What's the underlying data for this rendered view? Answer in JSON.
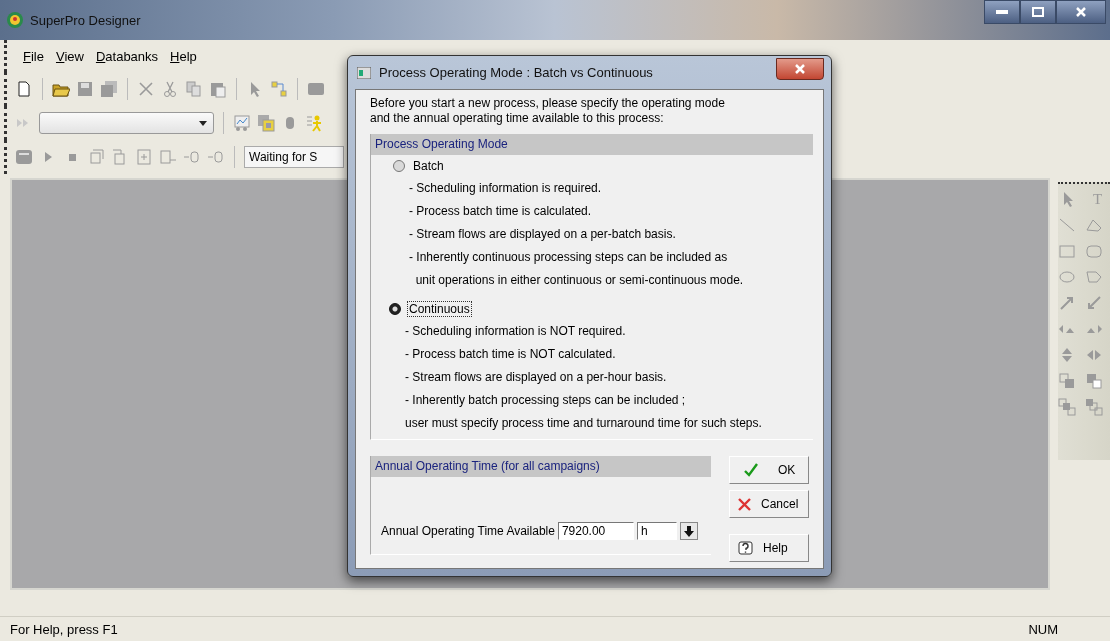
{
  "window": {
    "title": "SuperPro Designer"
  },
  "menu": [
    "File",
    "View",
    "Databanks",
    "Help"
  ],
  "toolbar": {
    "status_field": "Waiting for S"
  },
  "palette": {
    "text_tool": "T"
  },
  "dialog": {
    "title": "Process Operating Mode : Batch vs Continuous",
    "intro": [
      "Before you start a new process, please specify the operating mode",
      "and the annual operating time available to this process:"
    ],
    "mode_group": {
      "title": "Process Operating Mode",
      "options": [
        {
          "label": "Batch",
          "selected": false,
          "focused": false,
          "notes": [
            "- Scheduling information is required.",
            "- Process batch time is calculated.",
            "- Stream flows are displayed on a per-batch basis.",
            "- Inherently continuous processing steps can be included as",
            "  unit operations in either continuous or semi-continuous mode."
          ]
        },
        {
          "label": "Continuous",
          "selected": true,
          "focused": true,
          "notes": [
            "- Scheduling information is NOT required.",
            "- Process batch time is NOT calculated.",
            "- Stream flows are displayed on a per-hour basis.",
            "- Inherently batch processing steps can be included ;",
            "user must specify process time and turnaround time for such steps."
          ]
        }
      ]
    },
    "time_group": {
      "title": "Annual Operating Time (for all campaigns)",
      "label": "Annual Operating Time Available",
      "value": "7920.00",
      "unit": "h"
    },
    "buttons": [
      {
        "kind": "ok",
        "label": "OK"
      },
      {
        "kind": "cancel",
        "label": "Cancel"
      },
      {
        "kind": "help",
        "label": "Help"
      }
    ]
  },
  "status_bar": {
    "help": "For Help, press F1",
    "num": "NUM"
  }
}
